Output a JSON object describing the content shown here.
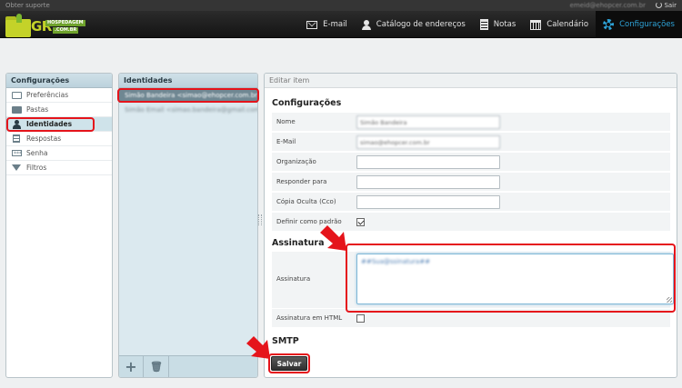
{
  "topbar": {
    "support_label": "Obter suporte",
    "user_email": "emeid@ehopcer.com.br",
    "logout_label": "Sair"
  },
  "logo": {
    "text": "GR",
    "tag_top": "HOSPEDAGEM",
    "tag_bottom": ".COM.BR"
  },
  "nav": {
    "items": [
      {
        "label": "E-mail",
        "icon": "mail-icon",
        "active": false
      },
      {
        "label": "Catálogo de endereços",
        "icon": "person-icon",
        "active": false
      },
      {
        "label": "Notas",
        "icon": "notes-icon",
        "active": false
      },
      {
        "label": "Calendário",
        "icon": "calendar-icon",
        "active": false
      },
      {
        "label": "Configurações",
        "icon": "gear-icon",
        "active": true
      }
    ]
  },
  "settings_panel": {
    "title": "Configurações",
    "items": [
      {
        "label": "Preferências",
        "icon": "monitor-icon"
      },
      {
        "label": "Pastas",
        "icon": "folder-icon"
      },
      {
        "label": "Identidades",
        "icon": "user-icon",
        "selected": true
      },
      {
        "label": "Respostas",
        "icon": "reply-icon"
      },
      {
        "label": "Senha",
        "icon": "password-icon"
      },
      {
        "label": "Filtros",
        "icon": "filter-icon"
      }
    ]
  },
  "identities_panel": {
    "title": "Identidades",
    "items": [
      {
        "label": "Simão Bandeira <simao@ehopcer.com.br>",
        "selected": true
      },
      {
        "label": "Simão Email <simao.bandeira@gmail.com>",
        "selected": false
      }
    ],
    "add_label": "+",
    "delete_label": "🗑"
  },
  "edit_panel": {
    "title": "Editar item",
    "section_settings": "Configurações",
    "fields": [
      {
        "label": "Nome",
        "value": "Simão Bandeira"
      },
      {
        "label": "E-Mail",
        "value": "simao@ehopcer.com.br"
      },
      {
        "label": "Organização",
        "value": ""
      },
      {
        "label": "Responder para",
        "value": ""
      },
      {
        "label": "Cópia Oculta (Cco)",
        "value": ""
      }
    ],
    "default_label": "Definir como padrão",
    "default_checked": true,
    "section_signature": "Assinatura",
    "signature_label": "Assinatura",
    "signature_value": "##Sua@ssinatura##",
    "signature_html_label": "Assinatura em HTML",
    "signature_html_checked": false,
    "section_smtp": "SMTP",
    "save_label": "Salvar"
  },
  "colors": {
    "accent": "#2ea3d8",
    "annotation": "#e5141b",
    "header": "#1e1e1e"
  }
}
